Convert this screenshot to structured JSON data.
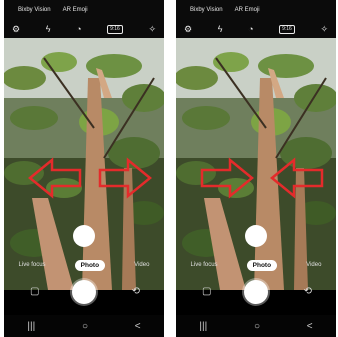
{
  "left_screen": {
    "top_menu": [
      "Bixby Vision",
      "AR Emoji"
    ],
    "icons": [
      "settings-icon",
      "flash-off-icon",
      "timer-icon",
      "ratio-icon",
      "filter-icon"
    ],
    "ratio_label": "9:16",
    "modes": [
      "Live focus",
      "Photo",
      "Video"
    ],
    "arrows": "pointing-outward"
  },
  "right_screen": {
    "top_menu": [
      "Bixby Vision",
      "AR Emoji"
    ],
    "icons": [
      "settings-icon",
      "flash-off-icon",
      "timer-icon",
      "ratio-icon",
      "filter-icon"
    ],
    "ratio_label": "9:16",
    "modes": [
      "Live focus",
      "Photo",
      "Video"
    ],
    "arrows": "pointing-inward"
  },
  "nav": {
    "recent": "|||",
    "home": "○",
    "back": "<"
  },
  "colors": {
    "arrow": "#e42b2b",
    "background": "#000000"
  }
}
